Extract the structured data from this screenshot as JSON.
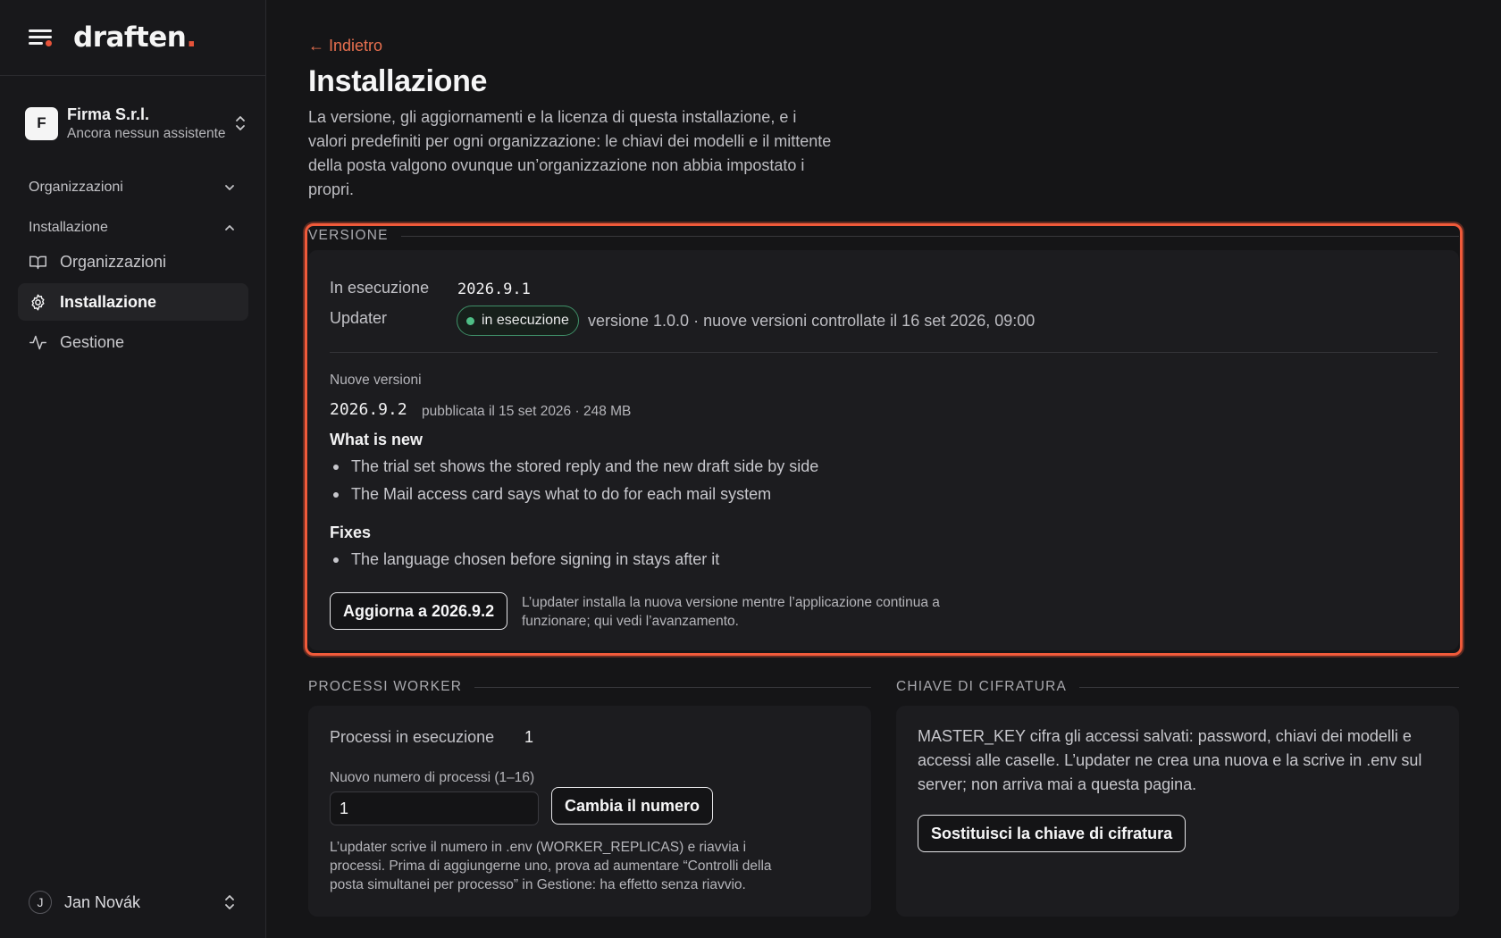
{
  "brand": {
    "name": "draften",
    "dot": "."
  },
  "org": {
    "initial": "F",
    "name": "Firma S.r.l.",
    "subtitle": "Ancora nessun assistente"
  },
  "nav": {
    "sections": [
      {
        "label": "Organizzazioni",
        "expanded": false
      },
      {
        "label": "Installazione",
        "expanded": true
      }
    ],
    "items": [
      {
        "label": "Organizzazioni",
        "icon": "book-icon"
      },
      {
        "label": "Installazione",
        "icon": "gear-icon",
        "active": true
      },
      {
        "label": "Gestione",
        "icon": "activity-icon"
      }
    ]
  },
  "user": {
    "initial": "J",
    "name": "Jan Novák"
  },
  "page": {
    "back": "← Indietro",
    "title": "Installazione",
    "description": "La versione, gli aggiornamenti e la licenza di questa installazione, e i valori predefiniti per ogni organizzazione: le chiavi dei modelli e il mittente della posta valgono ovunque un’organizzazione non abbia impostato i propri."
  },
  "version": {
    "section_label": "VERSIONE",
    "running_label": "In esecuzione",
    "running_value": "2026.9.1",
    "updater_label": "Updater",
    "updater_status": "in esecuzione",
    "updater_info": "versione 1.0.0 · nuove versioni controllate il 16 set 2026, 09:00",
    "new_versions_label": "Nuove versioni",
    "new_version": "2026.9.2",
    "new_version_meta": "pubblicata il 15 set 2026 · 248 MB",
    "whats_new_title": "What is new",
    "whats_new": [
      "The trial set shows the stored reply and the new draft side by side",
      "The Mail access card says what to do for each mail system"
    ],
    "fixes_title": "Fixes",
    "fixes": [
      "The language chosen before signing in stays after it"
    ],
    "update_button": "Aggiorna a 2026.9.2",
    "update_note": "L’updater installa la nuova versione mentre l’applicazione continua a funzionare; qui vedi l’avanzamento."
  },
  "workers": {
    "section_label": "PROCESSI WORKER",
    "running_label": "Processi in esecuzione",
    "running_value": "1",
    "new_count_label": "Nuovo numero di processi (1–16)",
    "new_count_value": "1",
    "change_button": "Cambia il numero",
    "note": "L’updater scrive il numero in .env (WORKER_REPLICAS) e riavvia i processi. Prima di aggiungerne uno, prova ad aumentare “Controlli della posta simultanei per processo” in Gestione: ha effetto senza riavvio."
  },
  "encryption": {
    "section_label": "CHIAVE DI CIFRATURA",
    "description": "MASTER_KEY cifra gli accessi salvati: password, chiavi dei modelli e accessi alle caselle. L’updater ne crea una nuova e la scrive in .env sul server; non arriva mai a questa pagina.",
    "replace_button": "Sostituisci la chiave di cifratura"
  },
  "colors": {
    "accent": "#e5533a",
    "link": "#e8704f",
    "success": "#4fbf86",
    "background": "#151517"
  }
}
